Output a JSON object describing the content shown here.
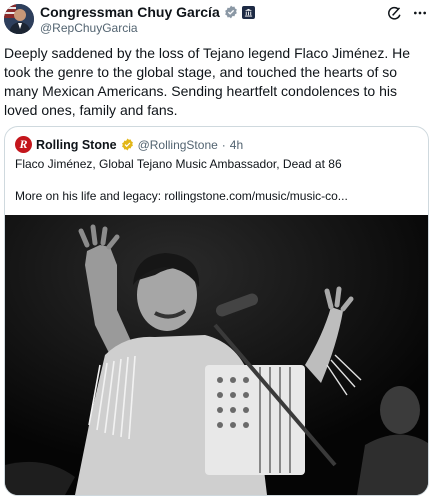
{
  "author": {
    "name": "Congressman Chuy García",
    "handle": "@RepChuyGarcia"
  },
  "header_icons": [
    "grok-icon",
    "more-icon"
  ],
  "tweet": {
    "text": "Deeply saddened by the loss of Tejano legend Flaco Jiménez. He took the genre to the global stage, and touched the hearts of so many Mexican Americans. Sending heartfelt condolences to his loved ones, family and fans."
  },
  "quote": {
    "logo_letter": "R",
    "name": "Rolling Stone",
    "handle": "@RollingStone",
    "separator": "·",
    "time": "4h",
    "line1": "Flaco Jiménez, Global Tejano Music Ambassador, Dead at 86",
    "line2": "More on his life and legacy: rollingstone.com/music/music-co..."
  },
  "colors": {
    "verified_blue": "#1d9bf0",
    "verified_gold": "#e2b719",
    "logo_red": "#c4161c"
  }
}
